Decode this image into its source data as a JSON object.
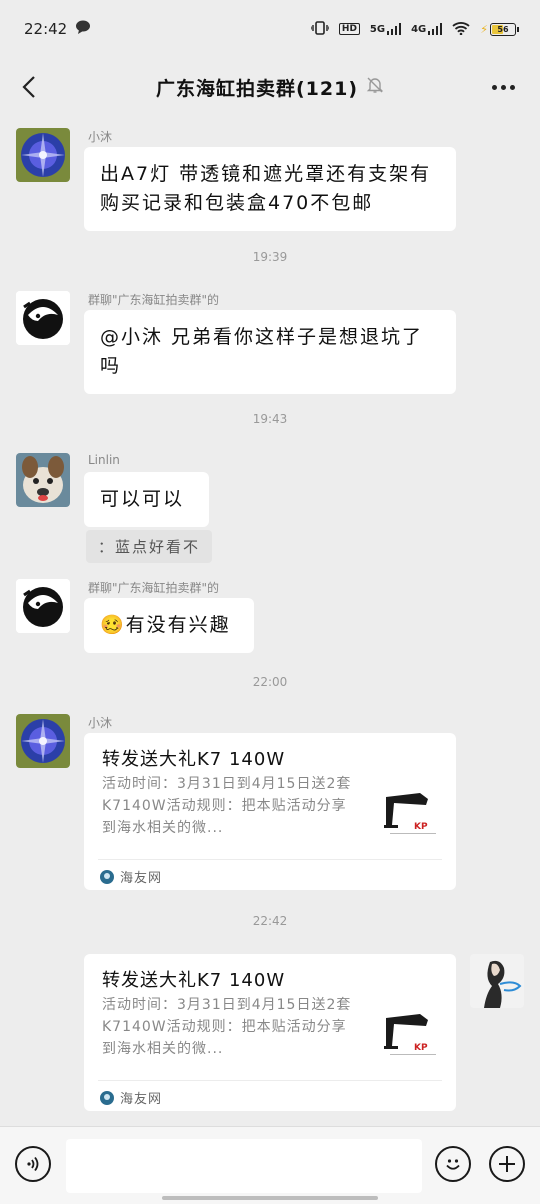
{
  "status": {
    "time": "22:42",
    "hd": "HD",
    "net5g": "5G",
    "net4g": "4G",
    "battery": "56"
  },
  "header": {
    "title": "广东海缸拍卖群(121)"
  },
  "messages": [
    {
      "sender": "小沐",
      "text": "出A7灯 带透镜和遮光罩还有支架有购买记录和包装盒470不包邮"
    },
    {
      "timestamp": "19:39"
    },
    {
      "sender": "群聊\"广东海缸拍卖群\"的",
      "text": "@小沐  兄弟看你这样子是想退坑了吗"
    },
    {
      "timestamp": "19:43"
    },
    {
      "sender": "Linlin",
      "text": "可以可以",
      "quote": "：蓝点好看不"
    },
    {
      "sender": "群聊\"广东海缸拍卖群\"的",
      "emoji": "🥴",
      "text": "有没有兴趣"
    },
    {
      "timestamp": "22:00"
    },
    {
      "sender": "小沐",
      "card": {
        "title": "转发送大礼K7 140W",
        "desc": "活动时间：3月31日到4月15日送2套K7140W活动规则：把本贴活动分享到海水相关的微...",
        "source": "海友网"
      }
    },
    {
      "timestamp": "22:42"
    },
    {
      "self": true,
      "card": {
        "title": "转发送大礼K7 140W",
        "desc": "活动时间：3月31日到4月15日送2套K7140W活动规则：把本贴活动分享到海水相关的微...",
        "source": "海友网"
      }
    }
  ],
  "colors": {
    "background": "#ededed",
    "bubble": "#ffffff",
    "meta_text": "#888888"
  }
}
